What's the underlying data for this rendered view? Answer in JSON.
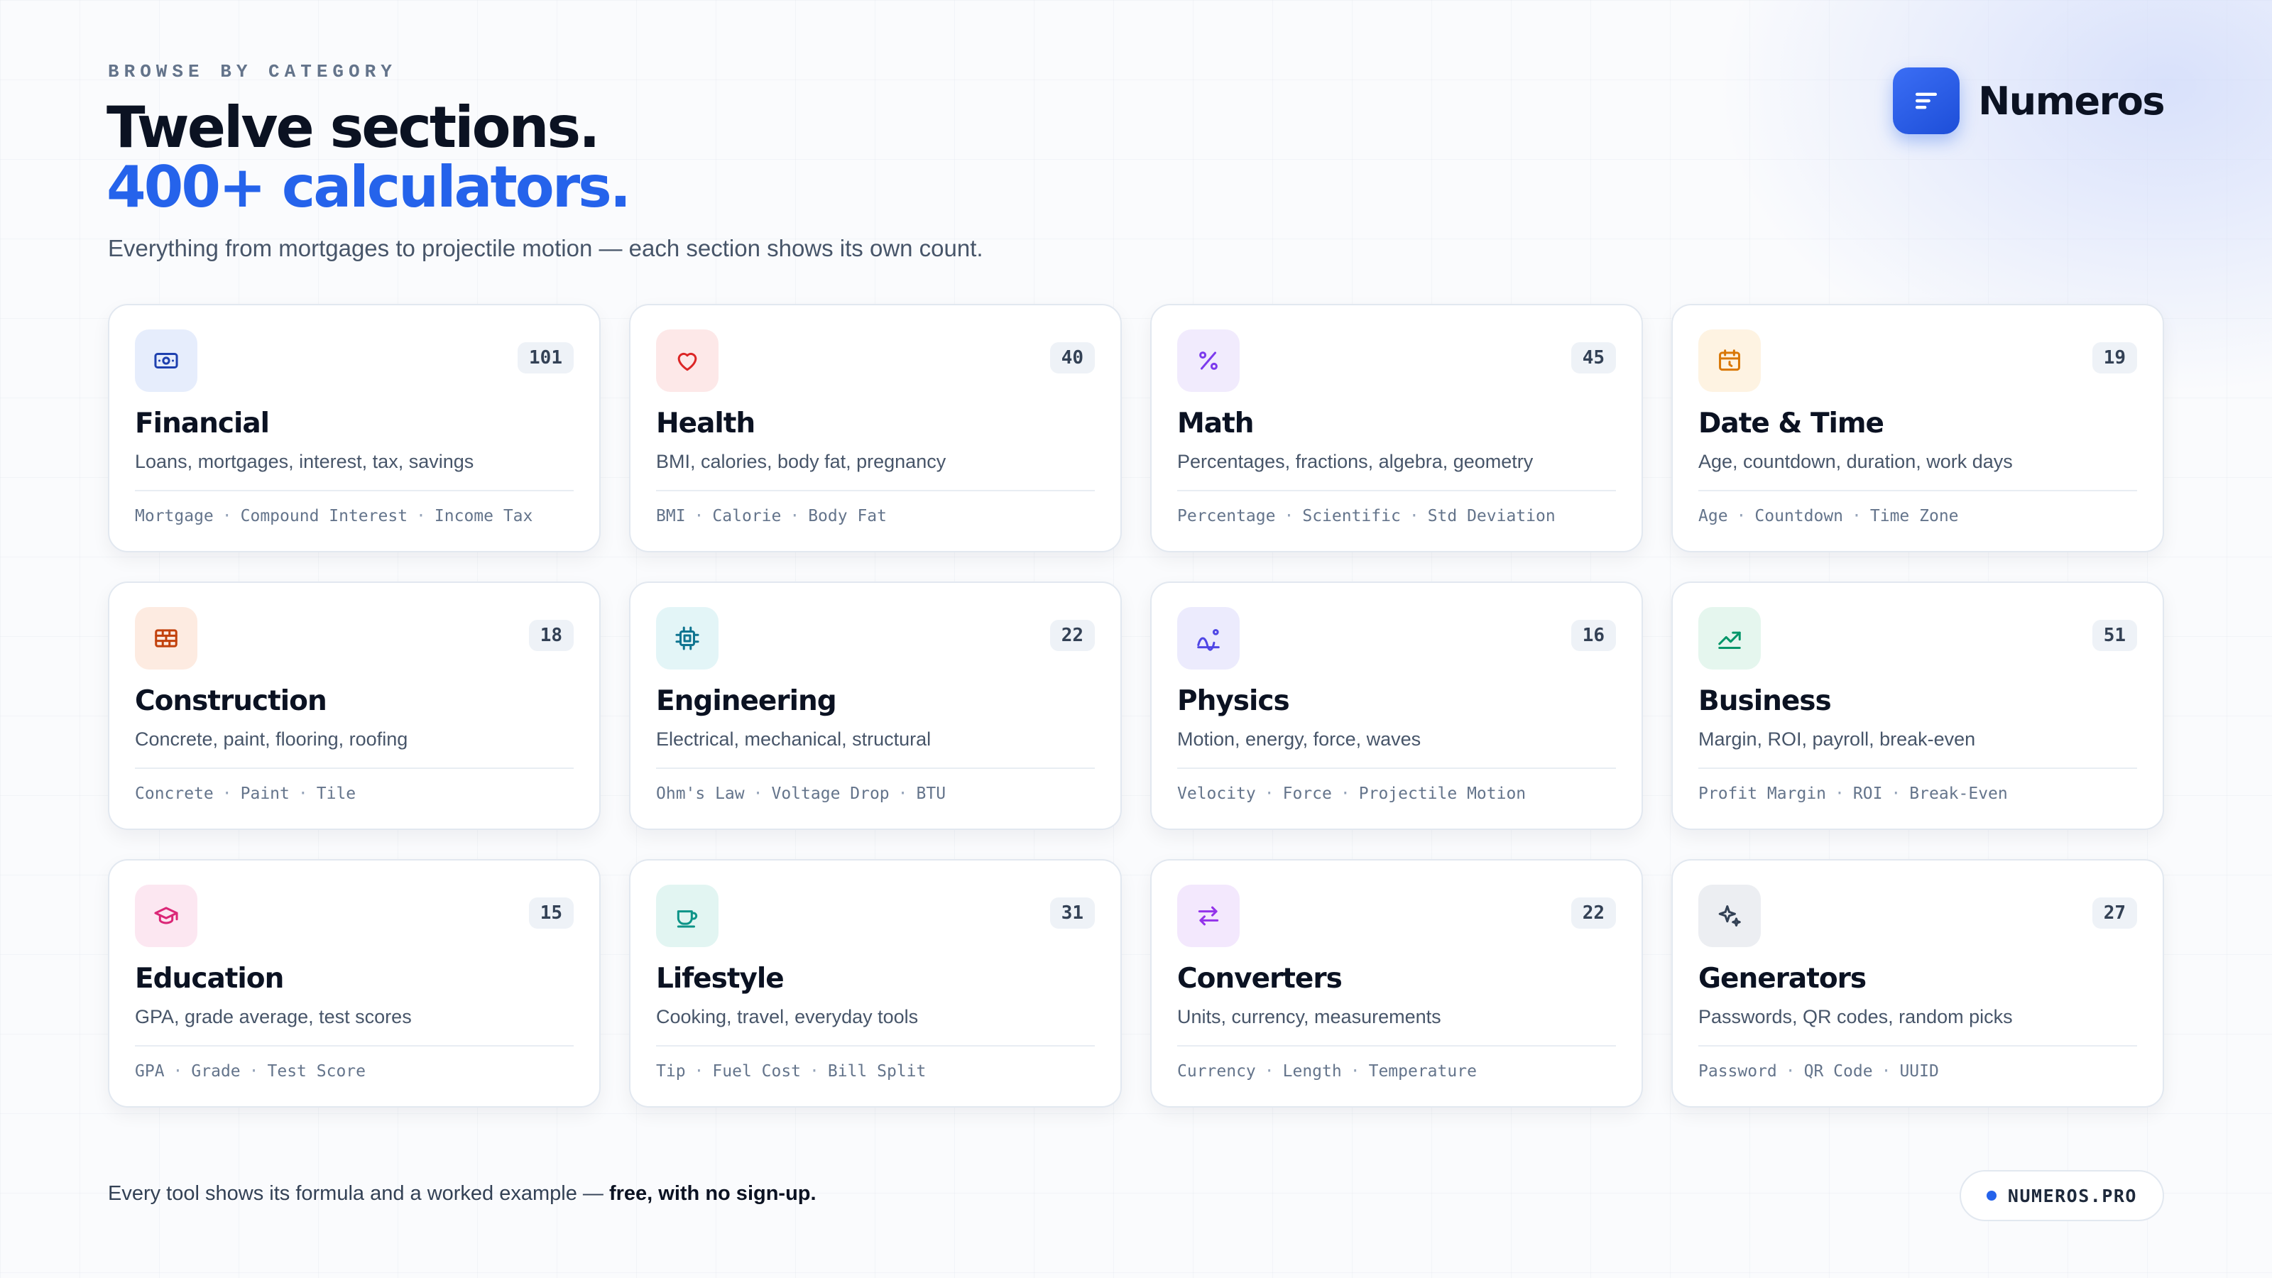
{
  "header": {
    "eyebrow": "BROWSE BY CATEGORY",
    "title_line1": "Twelve sections.",
    "title_line2": "400+ calculators.",
    "subtitle": "Everything from mortgages to projectile motion — each section shows its own count."
  },
  "brand": {
    "name": "Numeros",
    "logo_icon": "lines-icon",
    "accent_color": "#2563eb"
  },
  "categories": [
    {
      "name": "Financial",
      "count": "101",
      "description": "Loans, mortgages, interest, tax, savings",
      "tags": [
        "Mortgage",
        "Compound Interest",
        "Income Tax"
      ],
      "icon": "banknote-icon",
      "color": "#1e40af",
      "bg": "#e6edfc"
    },
    {
      "name": "Health",
      "count": "40",
      "description": "BMI, calories, body fat, pregnancy",
      "tags": [
        "BMI",
        "Calorie",
        "Body Fat"
      ],
      "icon": "heart-icon",
      "color": "#dc2626",
      "bg": "#fde8e8"
    },
    {
      "name": "Math",
      "count": "45",
      "description": "Percentages, fractions, algebra, geometry",
      "tags": [
        "Percentage",
        "Scientific",
        "Std Deviation"
      ],
      "icon": "percent-icon",
      "color": "#7c3aed",
      "bg": "#f1ebfd"
    },
    {
      "name": "Date & Time",
      "count": "19",
      "description": "Age, countdown, duration, work days",
      "tags": [
        "Age",
        "Countdown",
        "Time Zone"
      ],
      "icon": "calendar-icon",
      "color": "#d97706",
      "bg": "#fef3e2"
    },
    {
      "name": "Construction",
      "count": "18",
      "description": "Concrete, paint, flooring, roofing",
      "tags": [
        "Concrete",
        "Paint",
        "Tile"
      ],
      "icon": "brick-wall-icon",
      "color": "#c2410c",
      "bg": "#fdebe1"
    },
    {
      "name": "Engineering",
      "count": "22",
      "description": "Electrical, mechanical, structural",
      "tags": [
        "Ohm's Law",
        "Voltage Drop",
        "BTU"
      ],
      "icon": "cpu-chip-icon",
      "color": "#0e7490",
      "bg": "#e3f5f7"
    },
    {
      "name": "Physics",
      "count": "16",
      "description": "Motion, energy, force, waves",
      "tags": [
        "Velocity",
        "Force",
        "Projectile Motion"
      ],
      "icon": "trajectory-icon",
      "color": "#4f46e5",
      "bg": "#ecebfd"
    },
    {
      "name": "Business",
      "count": "51",
      "description": "Margin, ROI, payroll, break-even",
      "tags": [
        "Profit Margin",
        "ROI",
        "Break-Even"
      ],
      "icon": "trending-up-icon",
      "color": "#059669",
      "bg": "#e5f6ee"
    },
    {
      "name": "Education",
      "count": "15",
      "description": "GPA, grade average, test scores",
      "tags": [
        "GPA",
        "Grade",
        "Test Score"
      ],
      "icon": "graduation-cap-icon",
      "color": "#db2777",
      "bg": "#fce7f1"
    },
    {
      "name": "Lifestyle",
      "count": "31",
      "description": "Cooking, travel, everyday tools",
      "tags": [
        "Tip",
        "Fuel Cost",
        "Bill Split"
      ],
      "icon": "coffee-cup-icon",
      "color": "#0d9488",
      "bg": "#e2f5f2"
    },
    {
      "name": "Converters",
      "count": "22",
      "description": "Units, currency, measurements",
      "tags": [
        "Currency",
        "Length",
        "Temperature"
      ],
      "icon": "arrows-exchange-icon",
      "color": "#9333ea",
      "bg": "#f3e8fd"
    },
    {
      "name": "Generators",
      "count": "27",
      "description": "Passwords, QR codes, random picks",
      "tags": [
        "Password",
        "QR Code",
        "UUID"
      ],
      "icon": "sparkles-icon",
      "color": "#334155",
      "bg": "#eceef2"
    }
  ],
  "footer": {
    "note_prefix": "Every tool shows its formula and a worked example — ",
    "note_bold": "free, with no sign-up.",
    "site": "NUMEROS.PRO"
  }
}
